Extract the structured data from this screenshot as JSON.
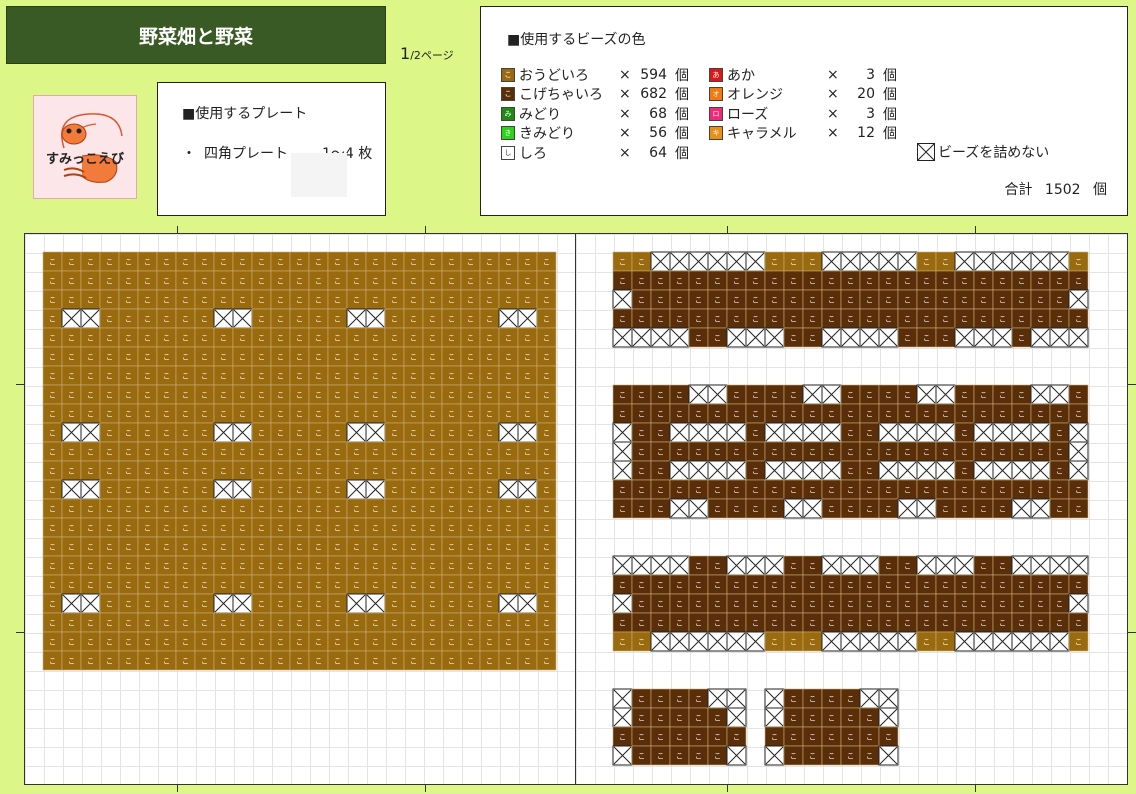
{
  "title": "野菜畑と野菜",
  "page": {
    "current": "1",
    "suffix": "/2ページ"
  },
  "logo": {
    "text": "すみっこえび"
  },
  "plate": {
    "heading": "■使用するプレート",
    "bullet": "・",
    "name": "四角プレート",
    "count": "1〜4 枚"
  },
  "beads": {
    "heading": "■使用するビーズの色",
    "left": [
      {
        "code": "こ",
        "name": "おうどいろ",
        "x": "×",
        "count": "594",
        "unit": "個",
        "color": "#9a6a0f"
      },
      {
        "code": "こ",
        "name": "こげちゃいろ",
        "x": "×",
        "count": "682",
        "unit": "個",
        "color": "#5a2e08"
      },
      {
        "code": "み",
        "name": "みどり",
        "x": "×",
        "count": "68",
        "unit": "個",
        "color": "#1e8a12"
      },
      {
        "code": "き",
        "name": "きみどり",
        "x": "×",
        "count": "56",
        "unit": "個",
        "color": "#2ad31a"
      },
      {
        "code": "し",
        "name": "しろ",
        "x": "×",
        "count": "64",
        "unit": "個",
        "color": "#ffffff"
      }
    ],
    "right": [
      {
        "code": "あ",
        "name": "あか",
        "x": "×",
        "count": "3",
        "unit": "個",
        "color": "#e01515"
      },
      {
        "code": "オ",
        "name": "オレンジ",
        "x": "×",
        "count": "20",
        "unit": "個",
        "color": "#f07a10"
      },
      {
        "code": "ロ",
        "name": "ローズ",
        "x": "×",
        "count": "3",
        "unit": "個",
        "color": "#f02a78"
      },
      {
        "code": "キ",
        "name": "キャラメル",
        "x": "×",
        "count": "12",
        "unit": "個",
        "color": "#e8901a"
      }
    ],
    "skip_label": "ビーズを詰めない",
    "total_label": "合計",
    "total_count": "1502",
    "total_unit": "個"
  },
  "colors": {
    "ochre": "#9a6a0f",
    "brown": "#5a2e08",
    "cell_glyph": "こ"
  }
}
